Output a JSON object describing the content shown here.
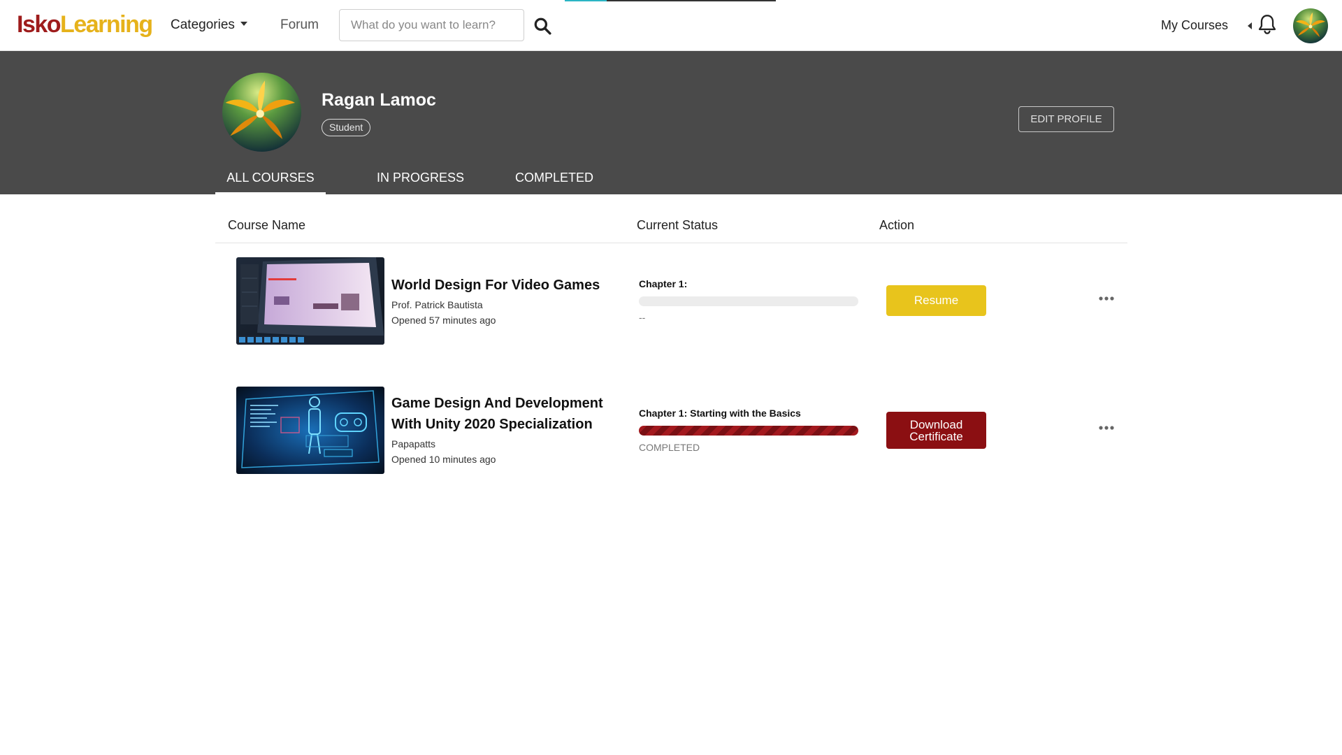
{
  "navbar": {
    "logo_part1": "Isko",
    "logo_part2": "Learning",
    "categories_label": "Categories",
    "forum_label": "Forum",
    "search_placeholder": "What do you want to learn?",
    "my_courses_label": "My Courses",
    "icons": [
      "search-icon",
      "chevron-left-icon",
      "bell-icon",
      "avatar"
    ]
  },
  "profile": {
    "name": "Ragan Lamoc",
    "role": "Student",
    "edit_label": "EDIT PROFILE"
  },
  "tabs": [
    {
      "label": "ALL COURSES",
      "active": true
    },
    {
      "label": "IN PROGRESS",
      "active": false
    },
    {
      "label": "COMPLETED",
      "active": false
    }
  ],
  "table": {
    "headers": [
      "Course Name",
      "Current Status",
      "Action"
    ],
    "rows": [
      {
        "title": "World Design For Video Games",
        "author": "Prof. Patrick Bautista",
        "opened": "Opened 57 minutes ago",
        "chapter": "Chapter 1:",
        "progress": 0,
        "status": "--",
        "action": "Resume"
      },
      {
        "title": "Game Design And Development With Unity 2020 Specialization",
        "author": "Papapatts",
        "opened": "Opened 10 minutes ago",
        "chapter": "Chapter 1: Starting with the Basics",
        "progress": 1,
        "status": "COMPLETED",
        "action": "Download Certificate"
      }
    ]
  },
  "colors": {
    "logo_red": "#9e1c1c",
    "logo_gold": "#e6b21b",
    "banner": "#4a4a4a",
    "resume": "#e8c41c",
    "certificate": "#8b0f12"
  }
}
